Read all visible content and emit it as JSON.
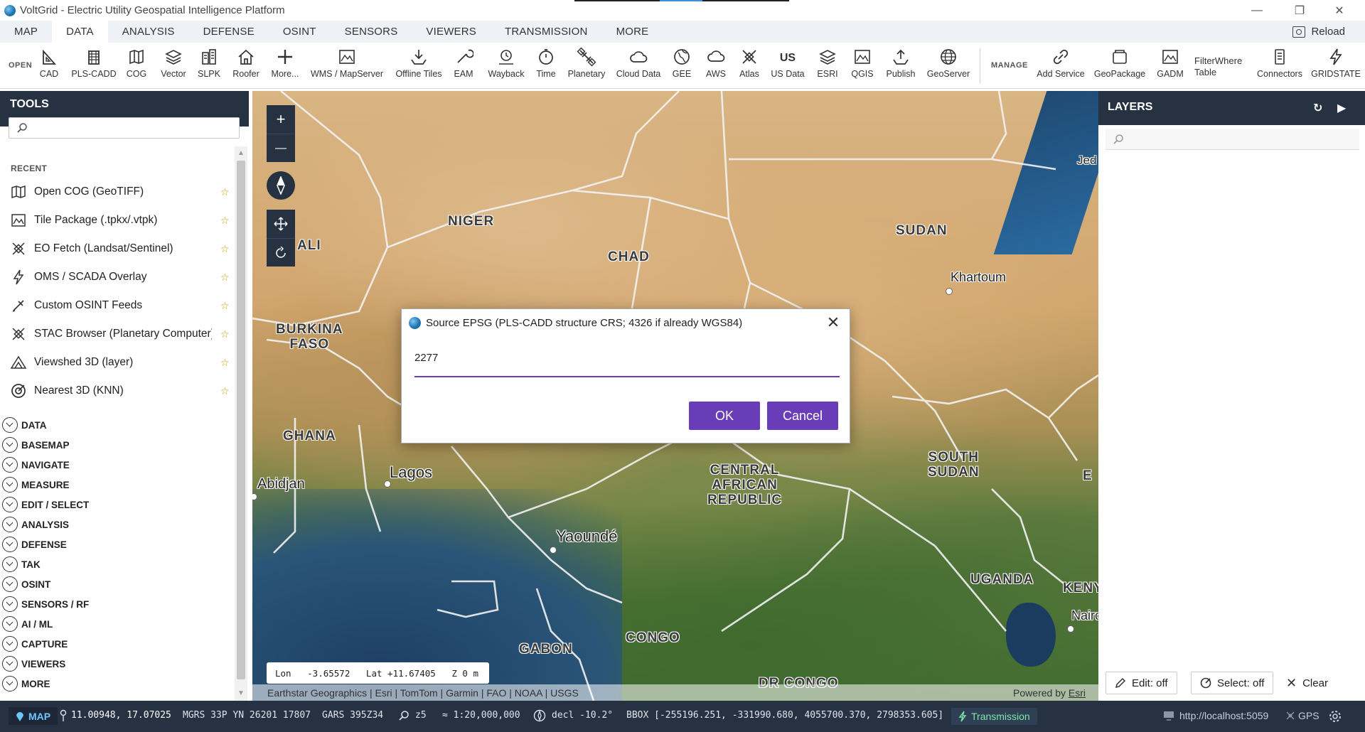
{
  "window": {
    "title": "VoltGrid - Electric Utility Geospatial Intelligence Platform"
  },
  "menu": {
    "tabs": [
      "MAP",
      "DATA",
      "ANALYSIS",
      "DEFENSE",
      "OSINT",
      "SENSORS",
      "VIEWERS",
      "TRANSMISSION",
      "MORE"
    ],
    "active": "DATA",
    "reload": "Reload"
  },
  "ribbon": {
    "open_label": "OPEN",
    "manage_label": "MANAGE",
    "buttons": {
      "cad": "CAD",
      "plscadd": "PLS-CADD",
      "cog": "COG",
      "vector": "Vector",
      "slpk": "SLPK",
      "roofer": "Roofer",
      "more": "More...",
      "wms": "WMS / MapServer",
      "offline": "Offline Tiles",
      "eam": "EAM",
      "wayback": "Wayback",
      "time": "Time",
      "planetary": "Planetary",
      "cloud": "Cloud Data",
      "gee": "GEE",
      "aws": "AWS",
      "atlas": "Atlas",
      "usdata": "US Data",
      "esri": "ESRI",
      "qgis": "QGIS",
      "publish": "Publish",
      "geoserver": "GeoServer",
      "addservice": "Add Service",
      "geopackage": "GeoPackage",
      "gadm": "GADM",
      "filterwhere": "FilterWhere",
      "table": "Table",
      "connectors": "Connectors",
      "gridstate": "GRIDSTATE",
      "us_glyph": "US"
    }
  },
  "tools": {
    "title": "TOOLS",
    "search_placeholder": "",
    "recent_label": "RECENT",
    "recent": [
      {
        "label": "Open COG (GeoTIFF)",
        "icon": "map-fold-icon"
      },
      {
        "label": "Tile Package (.tpkx/.vtpk)",
        "icon": "tile-package-icon"
      },
      {
        "label": "EO Fetch (Landsat/Sentinel)",
        "icon": "satellite-icon"
      },
      {
        "label": "OMS / SCADA Overlay",
        "icon": "lightning-icon"
      },
      {
        "label": "Custom OSINT Feeds",
        "icon": "pen-feed-icon"
      },
      {
        "label": "STAC Browser (Planetary Computer)",
        "icon": "satellite-icon"
      },
      {
        "label": "Viewshed 3D (layer)",
        "icon": "viewshed-icon"
      },
      {
        "label": "Nearest 3D (KNN)",
        "icon": "target-icon"
      }
    ],
    "star": "☆",
    "categories": [
      "DATA",
      "BASEMAP",
      "NAVIGATE",
      "MEASURE",
      "EDIT / SELECT",
      "ANALYSIS",
      "DEFENSE",
      "TAK",
      "OSINT",
      "SENSORS / RF",
      "AI / ML",
      "CAPTURE",
      "VIEWERS",
      "MORE"
    ]
  },
  "map": {
    "labels": {
      "niger": "NIGER",
      "chad": "CHAD",
      "sudan": "SUDAN",
      "burkina": "BURKINA\nFASO",
      "mali": "ALI",
      "ghana": "GHANA",
      "car": "CENTRAL\nAFRICAN\nREPUBLIC",
      "southsudan": "SOUTH\nSUDAN",
      "uganda": "UGANDA",
      "congo": "CONGO",
      "gabon": "GABON",
      "drcongo": "DR CONGO",
      "kenya": "KENY",
      "jed": "Jed",
      "e": "E"
    },
    "cities": {
      "khartoum": "Khartoum",
      "lagos": "Lagos",
      "abidjan": "Abidjan",
      "yaounde": "Yaoundé",
      "nairobi": "Nairo"
    },
    "coords": "Lon   -3.65572   Lat +11.67405   Z 0 m",
    "attribution": "Earthstar Geographics | Esri | TomTom | Garmin | FAO | NOAA | USGS",
    "powered_prefix": "Powered by ",
    "powered_link": "Esri",
    "controls": {
      "zoom_in": "+",
      "zoom_out": "—"
    }
  },
  "dialog": {
    "title": "Source EPSG (PLS-CADD structure CRS; 4326 if already WGS84)",
    "value": "2277",
    "ok": "OK",
    "cancel": "Cancel",
    "close": "✕",
    "accent": "#6a3db8"
  },
  "layers": {
    "title": "LAYERS",
    "refresh": "↻",
    "play": "▶",
    "edit": "Edit: off",
    "select": "Select: off",
    "clear": "Clear"
  },
  "status": {
    "map": "MAP",
    "latlon": "11.00948, 17.07025",
    "mgrs": "MGRS 33P YN 26201 17807",
    "gars": "GARS 395Z34",
    "zoom": "z5",
    "scale": "≈ 1:20,000,000",
    "decl": "decl -10.2°",
    "bbox": "BBOX [-255196.251, -331990.680, 4055700.370, 2798353.605]",
    "transmission": "Transmission",
    "url": "http://localhost:5059",
    "gps": "GPS"
  },
  "colors": {
    "nav_dark": "#263142",
    "accent_purple": "#6a3db8",
    "status_green": "#7fe7a8"
  }
}
